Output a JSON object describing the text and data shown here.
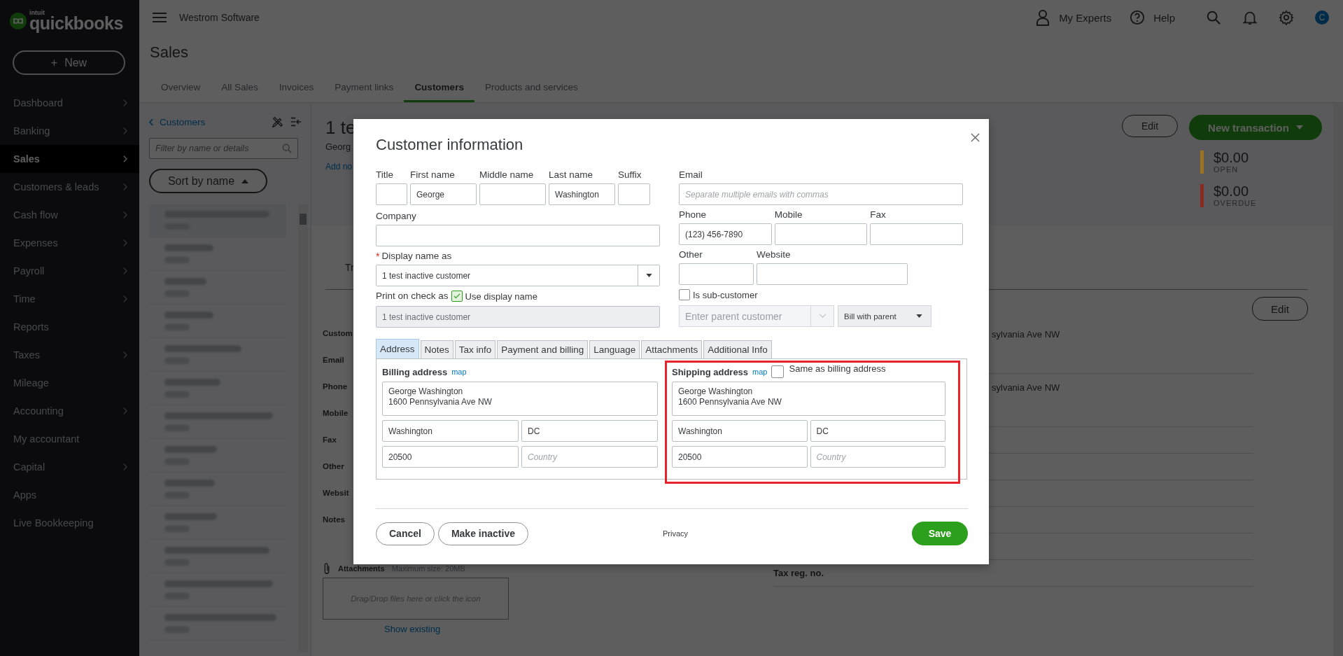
{
  "app": {
    "brand": "intuit",
    "product": "quickbooks",
    "new_plus": "+",
    "new_label": "New"
  },
  "sidebar": {
    "items": [
      {
        "label": "Dashboard",
        "selected": false,
        "expandable": true
      },
      {
        "label": "Banking",
        "selected": false,
        "expandable": true
      },
      {
        "label": "Sales",
        "selected": true,
        "expandable": true
      },
      {
        "label": "Customers & leads",
        "selected": false,
        "expandable": true
      },
      {
        "label": "Cash flow",
        "selected": false,
        "expandable": true
      },
      {
        "label": "Expenses",
        "selected": false,
        "expandable": true
      },
      {
        "label": "Payroll",
        "selected": false,
        "expandable": true
      },
      {
        "label": "Time",
        "selected": false,
        "expandable": true
      },
      {
        "label": "Reports",
        "selected": false,
        "expandable": false
      },
      {
        "label": "Taxes",
        "selected": false,
        "expandable": true
      },
      {
        "label": "Mileage",
        "selected": false,
        "expandable": false
      },
      {
        "label": "Accounting",
        "selected": false,
        "expandable": true
      },
      {
        "label": "My accountant",
        "selected": false,
        "expandable": false
      },
      {
        "label": "Capital",
        "selected": false,
        "expandable": true
      },
      {
        "label": "Apps",
        "selected": false,
        "expandable": false
      },
      {
        "label": "Live Bookkeeping",
        "selected": false,
        "expandable": false
      }
    ]
  },
  "top_bar": {
    "company": "Westrom Software",
    "experts": "My Experts",
    "help": "Help",
    "avatar": "C"
  },
  "page": {
    "title": "Sales",
    "tabs": [
      {
        "label": "Overview",
        "selected": false
      },
      {
        "label": "All Sales",
        "selected": false
      },
      {
        "label": "Invoices",
        "selected": false
      },
      {
        "label": "Payment links",
        "selected": false
      },
      {
        "label": "Customers",
        "selected": true
      },
      {
        "label": "Products and services",
        "selected": false
      }
    ]
  },
  "customer_list": {
    "back_link": "Customers",
    "filter_placeholder": "Filter by name or details",
    "sort_button": "Sort by name"
  },
  "customer_header": {
    "name": "1 te",
    "subtitle": "Georg",
    "add_notes": "Add no",
    "edit_button": "Edit",
    "new_transaction": "New transaction",
    "balances": [
      {
        "amount": "$0.00",
        "label": "OPEN",
        "color": "#9a7420"
      },
      {
        "amount": "$0.00",
        "label": "OVERDUE",
        "color": "#8b2a1c"
      }
    ]
  },
  "details": {
    "tab": "Tr",
    "edit_button": "Edit",
    "labels": [
      "Custom",
      "Email",
      "Phone",
      "Mobile",
      "Fax",
      "Other",
      "Websit",
      "Notes"
    ],
    "values": [
      "sylvania Ave NW",
      "sylvania Ave NW"
    ],
    "tax_label": "Tax reg. no.",
    "attachments": {
      "title": "Attachments",
      "limit": "Maximum size: 20MB",
      "drop_hint": "Drag/Drop files here or click the icon",
      "show_existing": "Show existing"
    }
  },
  "modal": {
    "title": "Customer information",
    "name_fields": [
      {
        "label": "Title"
      },
      {
        "label": "First name",
        "value": "George"
      },
      {
        "label": "Middle name"
      },
      {
        "label": "Last name",
        "value": "Washington"
      },
      {
        "label": "Suffix"
      }
    ],
    "email": {
      "label": "Email",
      "placeholder": "Separate multiple emails with commas"
    },
    "company": {
      "label": "Company"
    },
    "phones": [
      {
        "label": "Phone",
        "value": "(123) 456-7890"
      },
      {
        "label": "Mobile"
      },
      {
        "label": "Fax"
      }
    ],
    "display_name": {
      "label": "Display name as",
      "required_mark": "*",
      "value": "1 test inactive customer"
    },
    "other_fields": [
      {
        "label": "Other"
      },
      {
        "label": "Website"
      }
    ],
    "print_on_check": {
      "label": "Print on check as",
      "checkbox_label": "Use display name",
      "checked": true,
      "value": "1 test inactive customer"
    },
    "sub_customer": {
      "label": "Is sub-customer",
      "checked": false,
      "parent_placeholder": "Enter parent customer",
      "billing": "Bill with parent"
    },
    "tabs": [
      {
        "label": "Address",
        "selected": true
      },
      {
        "label": "Notes",
        "selected": false
      },
      {
        "label": "Tax info",
        "selected": false
      },
      {
        "label": "Payment and billing",
        "selected": false
      },
      {
        "label": "Language",
        "selected": false
      },
      {
        "label": "Attachments",
        "selected": false
      },
      {
        "label": "Additional Info",
        "selected": false
      }
    ],
    "billing": {
      "title": "Billing address",
      "map_link": "map",
      "street": "George Washington\n1600 Pennsylvania Ave NW",
      "city": "Washington",
      "state": "DC",
      "zip": "20500",
      "country_placeholder": "Country"
    },
    "shipping": {
      "title": "Shipping address",
      "map_link": "map",
      "same_label": "Same as billing address",
      "same_checked": false,
      "highlighted": true,
      "street": "George Washington\n1600 Pennsylvania Ave NW",
      "city": "Washington",
      "state": "DC",
      "zip": "20500",
      "country_placeholder": "Country"
    },
    "buttons": {
      "cancel": "Cancel",
      "make_inactive": "Make inactive",
      "privacy": "Privacy",
      "save": "Save"
    }
  }
}
